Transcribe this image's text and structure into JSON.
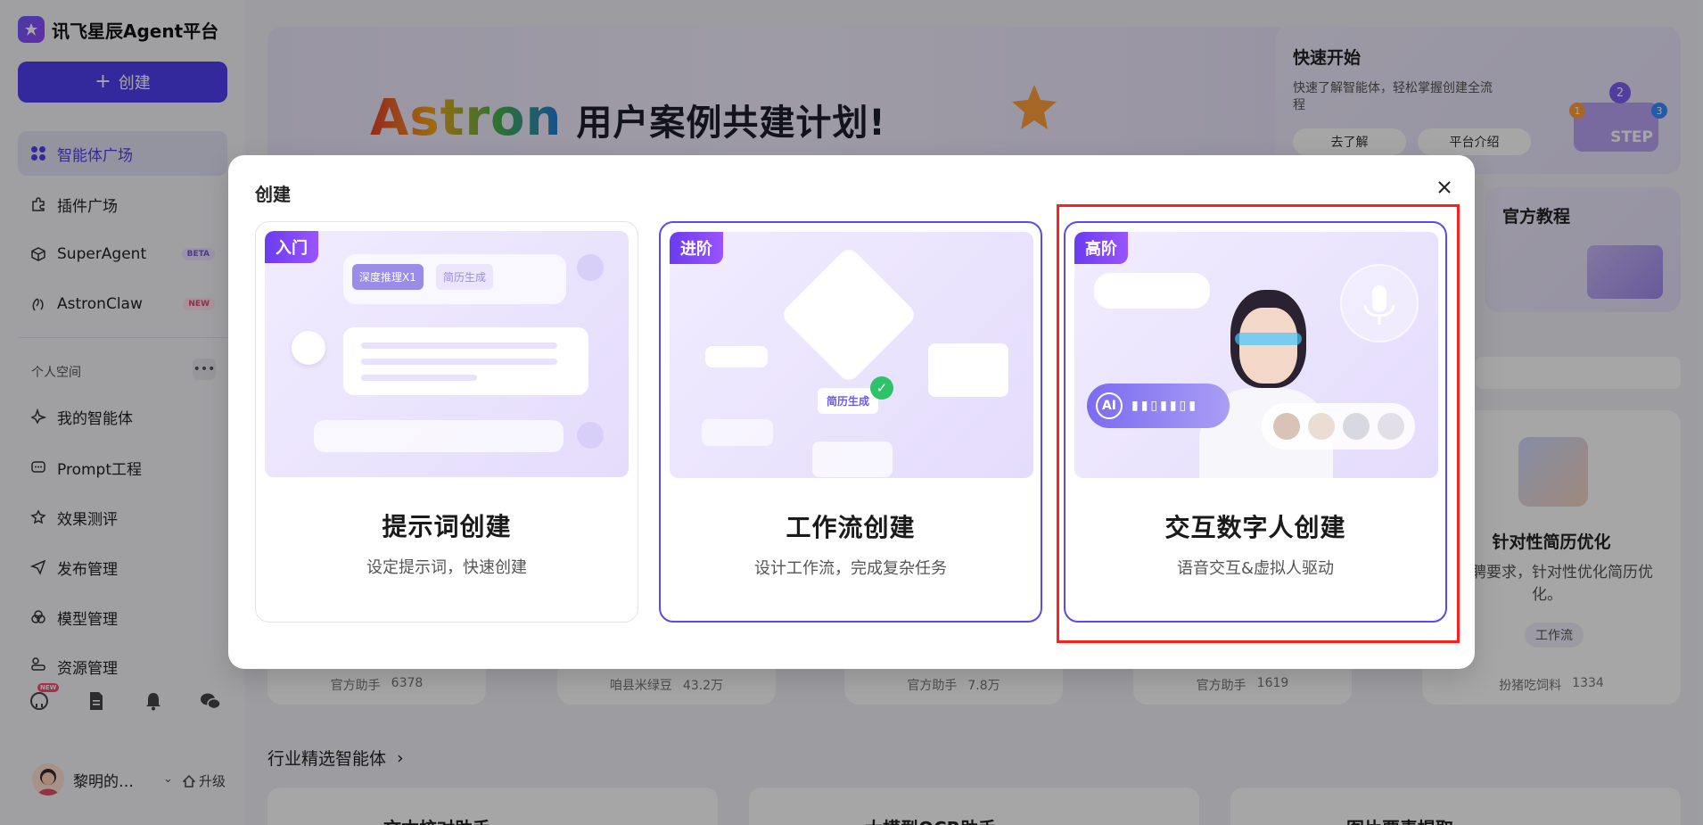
{
  "app": {
    "title": "讯飞星辰Agent平台"
  },
  "sidebar": {
    "create_label": "创建",
    "items": [
      {
        "label": "智能体广场",
        "icon": "grid-icon",
        "active": true
      },
      {
        "label": "插件广场",
        "icon": "puzzle-icon"
      },
      {
        "label": "SuperAgent",
        "icon": "cube-icon",
        "badge": "BETA"
      },
      {
        "label": "AstronClaw",
        "icon": "claw-icon",
        "badge": "NEW"
      }
    ],
    "personal_section": "个人空间",
    "personal_items": [
      {
        "label": "我的智能体",
        "icon": "sparkle-icon"
      },
      {
        "label": "Prompt工程",
        "icon": "prompt-icon"
      },
      {
        "label": "效果测评",
        "icon": "evaluate-icon"
      },
      {
        "label": "发布管理",
        "icon": "send-icon"
      },
      {
        "label": "模型管理",
        "icon": "model-icon"
      },
      {
        "label": "资源管理",
        "icon": "resource-icon"
      }
    ],
    "util_new_badge": "NEW",
    "user": {
      "name": "黎明的…",
      "upgrade": "升级"
    }
  },
  "banner": {
    "brand": "Astron",
    "subtitle": "用户案例共建计划!"
  },
  "quick_start": {
    "title": "快速开始",
    "desc": "快速了解智能体，轻松掌握创建全流程",
    "btn_learn": "去了解",
    "btn_intro": "平台介绍",
    "step_label": "STEP",
    "steps": [
      "1",
      "2",
      "3"
    ]
  },
  "tutorial": {
    "title": "官方教程"
  },
  "agent_cards": [
    {
      "author": "官方助手",
      "count": "6378"
    },
    {
      "author": "咱县米绿豆",
      "count": "43.2万"
    },
    {
      "author": "官方助手",
      "count": "7.8万"
    },
    {
      "author": "官方助手",
      "count": "1619"
    },
    {
      "author": "扮猪吃饲料",
      "count": "1334",
      "title": "针对性简历优化",
      "desc": "据招聘要求，针对性优化简历优化。",
      "tag": "工作流"
    }
  ],
  "section": {
    "title": "行业精选智能体"
  },
  "bottom_cards": [
    "文本校对助手",
    "大模型OCR助手",
    "图片要素提取"
  ],
  "modal": {
    "title": "创建",
    "options": [
      {
        "tag": "入门",
        "title": "提示词创建",
        "desc": "设定提示词，快速创建",
        "chip1": "深度推理X1",
        "chip2": "简历生成"
      },
      {
        "tag": "进阶",
        "title": "工作流创建",
        "desc": "设计工作流，完成复杂任务",
        "node_label": "简历生成"
      },
      {
        "tag": "高阶",
        "title": "交互数字人创建",
        "desc": "语音交互&虚拟人驱动",
        "ai_label": "AI"
      }
    ]
  }
}
